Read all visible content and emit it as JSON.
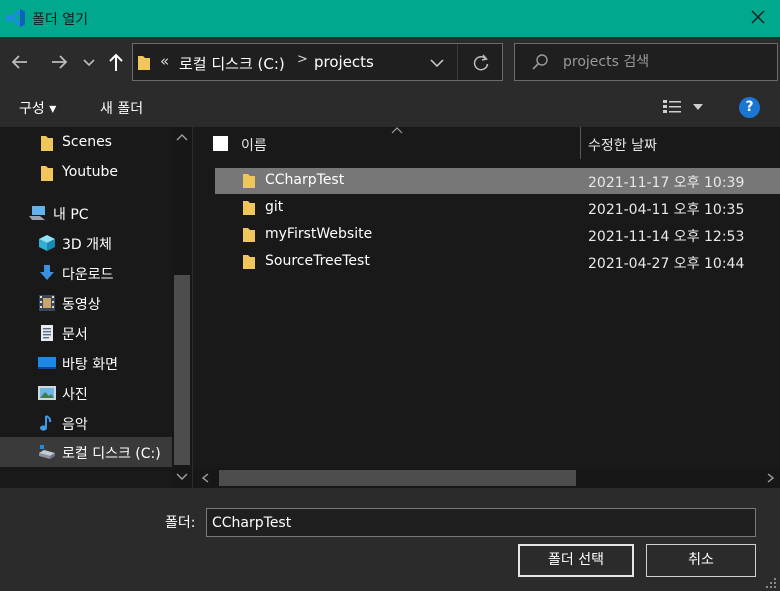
{
  "window": {
    "title": "폴더 열기",
    "app_icon": "vscode-icon",
    "accent_color": "#00a88e"
  },
  "address": {
    "chevrons": "«",
    "crumbs": [
      "로컬 디스크 (C:)",
      "projects"
    ],
    "separator": ">"
  },
  "search": {
    "placeholder": "projects 검색"
  },
  "commands": {
    "organize": "구성 ▾",
    "new_folder": "새 폴더",
    "help": "?"
  },
  "nav": {
    "items": [
      {
        "label": "Scenes",
        "icon": "folder-icon"
      },
      {
        "label": "Youtube",
        "icon": "folder-icon"
      },
      {
        "label": "내 PC",
        "icon": "pc-icon"
      },
      {
        "label": "3D 개체",
        "icon": "cube-icon"
      },
      {
        "label": "다운로드",
        "icon": "download-icon"
      },
      {
        "label": "동영상",
        "icon": "video-icon"
      },
      {
        "label": "문서",
        "icon": "document-icon"
      },
      {
        "label": "바탕 화면",
        "icon": "desktop-icon"
      },
      {
        "label": "사진",
        "icon": "picture-icon"
      },
      {
        "label": "음악",
        "icon": "music-icon"
      },
      {
        "label": "로컬 디스크 (C:)",
        "icon": "drive-icon"
      }
    ],
    "selected_index": 10
  },
  "list": {
    "columns": {
      "name": "이름",
      "date": "수정한 날짜"
    },
    "rows": [
      {
        "name": "CCharpTest",
        "date": "2021-11-17 오후 10:39"
      },
      {
        "name": "git",
        "date": "2021-04-11 오후 10:35"
      },
      {
        "name": "myFirstWebsite",
        "date": "2021-11-14 오후 12:53"
      },
      {
        "name": "SourceTreeTest",
        "date": "2021-04-27 오후 10:44"
      }
    ],
    "selected_index": 0
  },
  "footer": {
    "folder_label": "폴더:",
    "folder_value": "CCharpTest",
    "select_button": "폴더 선택",
    "cancel_button": "취소"
  }
}
